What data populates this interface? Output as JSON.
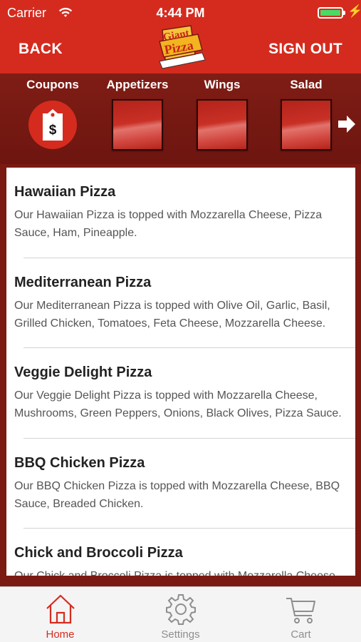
{
  "status_bar": {
    "carrier": "Carrier",
    "time": "4:44 PM",
    "battery_level": 1.0,
    "battery_color": "#4cd964"
  },
  "nav": {
    "back_label": "BACK",
    "sign_out_label": "SIGN OUT",
    "logo_icon": "giant-pizza-logo"
  },
  "categories": [
    {
      "label": "Coupons",
      "icon": "price-tag-icon"
    },
    {
      "label": "Appetizers",
      "icon": "category-tile"
    },
    {
      "label": "Wings",
      "icon": "category-tile"
    },
    {
      "label": "Salad",
      "icon": "category-tile"
    }
  ],
  "menu_items": [
    {
      "title": "Hawaiian Pizza",
      "description": "Our Hawaiian Pizza is topped with Mozzarella Cheese, Pizza Sauce, Ham, Pineapple."
    },
    {
      "title": "Mediterranean Pizza",
      "description": "Our Mediterranean Pizza is topped with Olive Oil, Garlic, Basil, Grilled Chicken, Tomatoes, Feta Cheese, Mozzarella Cheese."
    },
    {
      "title": "Veggie Delight Pizza",
      "description": "Our Veggie Delight Pizza is topped with Mozzarella Cheese, Mushrooms, Green Peppers, Onions, Black Olives, Pizza Sauce."
    },
    {
      "title": "BBQ Chicken Pizza",
      "description": "Our BBQ Chicken Pizza is topped with Mozzarella Cheese, BBQ Sauce, Breaded Chicken."
    },
    {
      "title": "Chick and Broccoli Pizza",
      "description": "Our Chick and Broccoli Pizza is topped with Mozzarella Cheese"
    }
  ],
  "tabs": [
    {
      "label": "Home",
      "icon": "home-icon",
      "active": true
    },
    {
      "label": "Settings",
      "icon": "gear-icon",
      "active": false
    },
    {
      "label": "Cart",
      "icon": "cart-icon",
      "active": false
    }
  ],
  "colors": {
    "brand_red": "#d52b1e",
    "dark_red": "#7a1a12",
    "tab_inactive": "#8e8e8e"
  }
}
